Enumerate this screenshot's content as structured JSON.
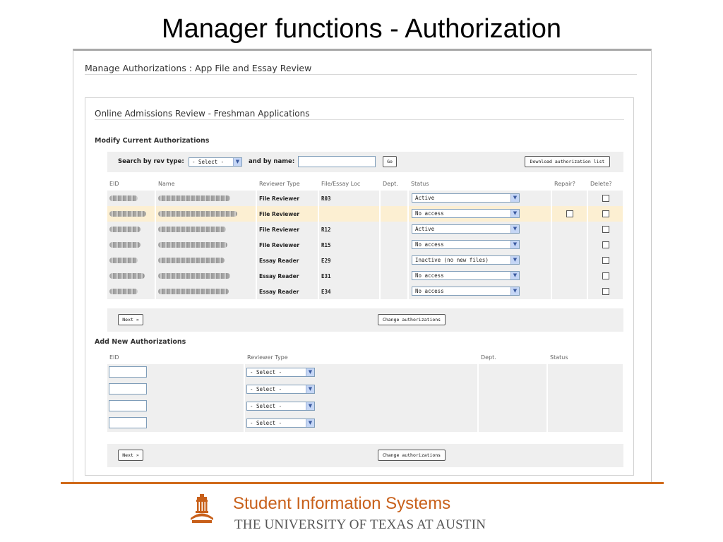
{
  "slide": {
    "title": "Manager functions - Authorization"
  },
  "window": {
    "title": "Manage Authorizations : App File and Essay Review",
    "panel_title": "Online Admissions Review - Freshman Applications"
  },
  "current": {
    "section_title": "Modify Current Authorizations",
    "search_rev_label": "Search by rev type:",
    "search_rev_value": "- Select -",
    "search_name_label": "and by name:",
    "search_name_value": "",
    "go_label": "Go",
    "download_label": "Download authorization list",
    "columns": {
      "eid": "EID",
      "name": "Name",
      "reviewer_type": "Reviewer Type",
      "file_loc": "File/Essay Loc",
      "dept": "Dept.",
      "status": "Status",
      "repair": "Repair?",
      "delete": "Delete?"
    },
    "rows": [
      {
        "reviewer_type": "File Reviewer",
        "file_loc": "R03",
        "status": "Active",
        "highlighted": false,
        "repair_box": false
      },
      {
        "reviewer_type": "File Reviewer",
        "file_loc": "",
        "status": "No access",
        "highlighted": true,
        "repair_box": true
      },
      {
        "reviewer_type": "File Reviewer",
        "file_loc": "R12",
        "status": "Active",
        "highlighted": false,
        "repair_box": false
      },
      {
        "reviewer_type": "File Reviewer",
        "file_loc": "R15",
        "status": "No access",
        "highlighted": false,
        "repair_box": false
      },
      {
        "reviewer_type": "Essay Reader",
        "file_loc": "E29",
        "status": "Inactive (no new files)",
        "highlighted": false,
        "repair_box": false
      },
      {
        "reviewer_type": "Essay Reader",
        "file_loc": "E31",
        "status": "No access",
        "highlighted": false,
        "repair_box": false
      },
      {
        "reviewer_type": "Essay Reader",
        "file_loc": "E34",
        "status": "No access",
        "highlighted": false,
        "repair_box": false
      }
    ],
    "next_label": "Next »",
    "change_label": "Change authorizations"
  },
  "add": {
    "section_title": "Add New Authorizations",
    "columns": {
      "eid": "EID",
      "reviewer_type": "Reviewer Type",
      "dept": "Dept.",
      "status": "Status"
    },
    "rows": [
      {
        "eid": "",
        "reviewer_type": "- Select -"
      },
      {
        "eid": "",
        "reviewer_type": "- Select -"
      },
      {
        "eid": "",
        "reviewer_type": "- Select -"
      },
      {
        "eid": "",
        "reviewer_type": "- Select -"
      }
    ],
    "next_label": "Next »",
    "change_label": "Change authorizations"
  },
  "footer": {
    "org_name": "Student Information Systems",
    "university": "THE UNIVERSITY OF TEXAS AT AUSTIN",
    "accent_color": "#c8601a"
  },
  "icons": {
    "dropdown": "chevron-down-icon",
    "logo": "tower-logo-icon"
  }
}
